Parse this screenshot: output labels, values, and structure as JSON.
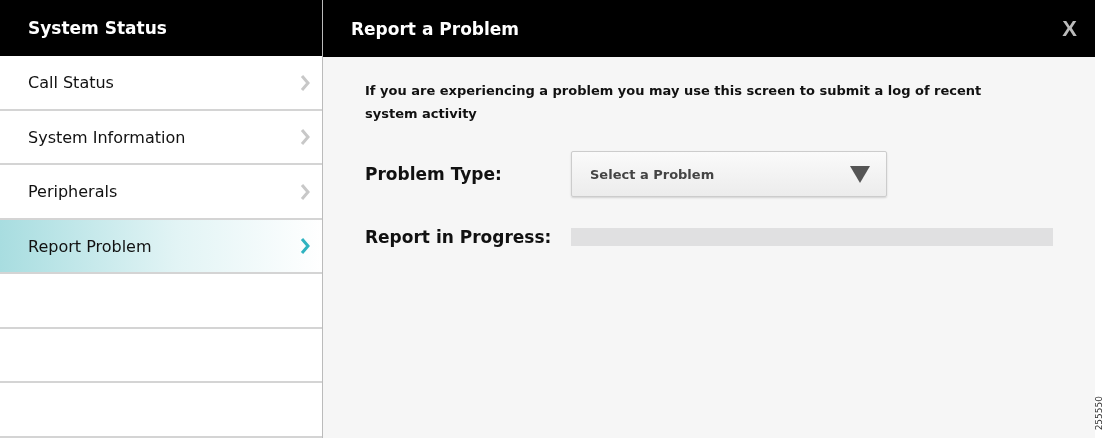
{
  "sidebar": {
    "title": "System Status",
    "items": [
      {
        "label": "Call Status",
        "selected": false
      },
      {
        "label": "System Information",
        "selected": false
      },
      {
        "label": "Peripherals",
        "selected": false
      },
      {
        "label": "Report Problem",
        "selected": true
      }
    ]
  },
  "panel": {
    "title": "Report a Problem",
    "close": "X",
    "description": "If you are experiencing a problem you may use this screen to submit a log of recent system activity",
    "problem_type": {
      "label": "Problem Type:",
      "placeholder": "Select a Problem"
    },
    "progress": {
      "label": "Report in Progress:",
      "level": 0
    }
  },
  "figure_id": "255550"
}
